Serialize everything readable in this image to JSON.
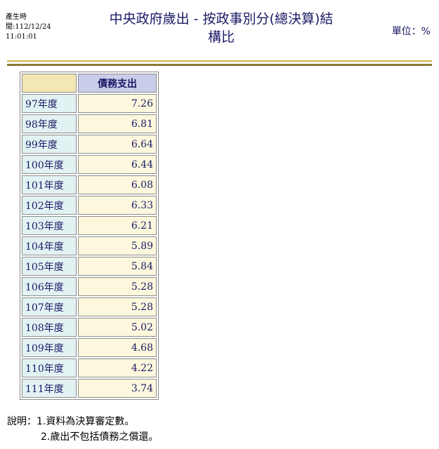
{
  "header": {
    "gen_time_label": "產生時",
    "gen_time_date": "間:112/12/24",
    "gen_time_clock": "11:01:01",
    "title_line1": "中央政府歲出 - 按政事別分(總決算)結",
    "title_line2": "構比",
    "unit": "單位：%"
  },
  "table": {
    "column_header": "債務支出",
    "rows": [
      {
        "year": "97年度",
        "value": "7.26"
      },
      {
        "year": "98年度",
        "value": "6.81"
      },
      {
        "year": "99年度",
        "value": "6.64"
      },
      {
        "year": "100年度",
        "value": "6.44"
      },
      {
        "year": "101年度",
        "value": "6.08"
      },
      {
        "year": "102年度",
        "value": "6.33"
      },
      {
        "year": "103年度",
        "value": "6.21"
      },
      {
        "year": "104年度",
        "value": "5.89"
      },
      {
        "year": "105年度",
        "value": "5.84"
      },
      {
        "year": "106年度",
        "value": "5.28"
      },
      {
        "year": "107年度",
        "value": "5.28"
      },
      {
        "year": "108年度",
        "value": "5.02"
      },
      {
        "year": "109年度",
        "value": "4.68"
      },
      {
        "year": "110年度",
        "value": "4.22"
      },
      {
        "year": "111年度",
        "value": "3.74"
      }
    ]
  },
  "notes": {
    "line1": "說明：1.資料為決算審定數。",
    "line2": "2.歲出不包括債務之償還。"
  },
  "colors": {
    "header_text": "#1a1a66",
    "rule_gold": "#c9b24a",
    "year_cell_bg": "#e2f2f3",
    "value_cell_bg": "#fdf8dd",
    "column_header_bg": "#c9cdea"
  }
}
